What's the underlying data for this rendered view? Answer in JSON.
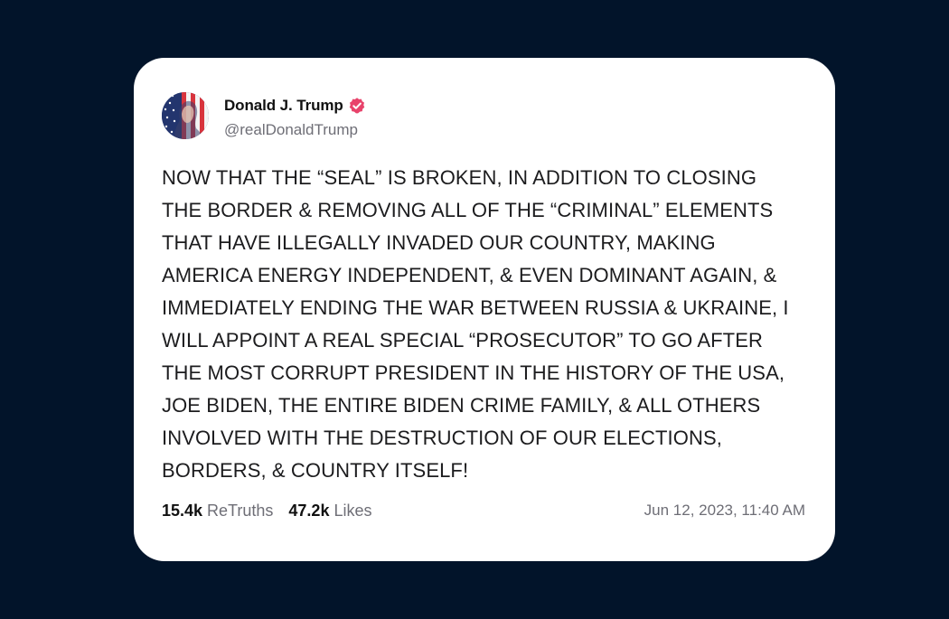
{
  "post": {
    "author": {
      "display_name": "Donald J. Trump",
      "handle": "@realDonaldTrump",
      "verified": true
    },
    "text": "NOW THAT THE “SEAL” IS BROKEN, IN ADDITION TO CLOSING\nTHE BORDER & REMOVING ALL OF THE “CRIMINAL” ELEMENTS\nTHAT HAVE ILLEGALLY INVADED OUR COUNTRY, MAKING\nAMERICA ENERGY INDEPENDENT, & EVEN DOMINANT AGAIN, &\nIMMEDIATELY ENDING THE WAR BETWEEN RUSSIA & UKRAINE, I\nWILL APPOINT A REAL SPECIAL “PROSECUTOR” TO GO AFTER\nTHE MOST CORRUPT PRESIDENT IN THE HISTORY OF THE USA,\nJOE BIDEN, THE ENTIRE BIDEN CRIME FAMILY, & ALL OTHERS\nINVOLVED WITH THE DESTRUCTION OF OUR ELECTIONS,\nBORDERS, & COUNTRY ITSELF!",
    "stats": {
      "retruths_count": "15.4k",
      "retruths_label": "ReTruths",
      "likes_count": "47.2k",
      "likes_label": "Likes"
    },
    "timestamp": "Jun 12, 2023, 11:40 AM"
  },
  "icons": {
    "verified": "verified-badge-icon",
    "avatar": "flag-portrait-avatar"
  },
  "colors": {
    "background": "#02142a",
    "card": "#ffffff",
    "text_primary": "#1c1c1e",
    "text_secondary": "#6e6e76",
    "verified_badge": "#e8436b"
  }
}
